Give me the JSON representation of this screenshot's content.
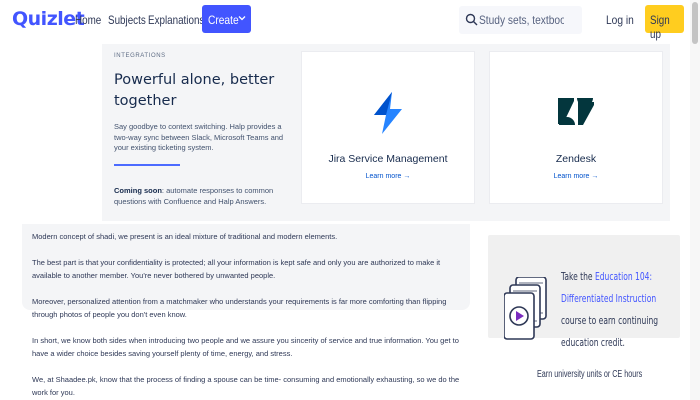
{
  "header": {
    "logo": "Quizlet",
    "nav": [
      "Home",
      "Subjects",
      "Explanations"
    ],
    "create_label": "Create",
    "search_placeholder": "Study sets, textbooks, ...",
    "login_label": "Log in",
    "signup_label": "Sign up",
    "accent_color": "#4255ff",
    "signup_color": "#ffcd1f"
  },
  "promo": {
    "eyebrow": "INTEGRATIONS",
    "headline": "Powerful alone, better together",
    "description": "Say goodbye to context switching. Halp provides a two-way sync between Slack, Microsoft Teams and your existing ticketing system.",
    "soon_label": "Coming soon",
    "soon_text": ": automate responses to common questions with Confluence and Halp Answers.",
    "cards": [
      {
        "title": "Jira Service Management",
        "link": "Learn more →",
        "icon": "jira-icon"
      },
      {
        "title": "Zendesk",
        "link": "Learn more →",
        "icon": "zendesk-icon"
      }
    ]
  },
  "article": {
    "paragraphs": [
      "Modern concept of shadi, we present is an ideal mixture of traditional and modern elements.",
      "The best part is that your confidentiality is protected; all your information is kept safe and only you are authorized to make it available to another member. You're never bothered by unwanted people.",
      "Moreover, personalized attention from a matchmaker who understands your requirements is far more comforting than flipping through photos of people you don't even know.",
      "In short, we know both sides when introducing two people and we assure you sincerity of service and true information. You get to have a wider choice besides saving yourself plenty of time, energy, and stress.",
      "We, at Shaadee.pk, know that the process of finding a spouse can be time- consuming and emotionally exhausting, so we do the work for you."
    ]
  },
  "side_ad": {
    "line1_pre": "Take the ",
    "line1_link": "Education 104:",
    "line2_link": "Differentiated Instruction",
    "line3": "course to earn continuing",
    "line4": "education credit.",
    "footer": "Earn university units or CE hours",
    "icon": "video-stack-icon"
  }
}
